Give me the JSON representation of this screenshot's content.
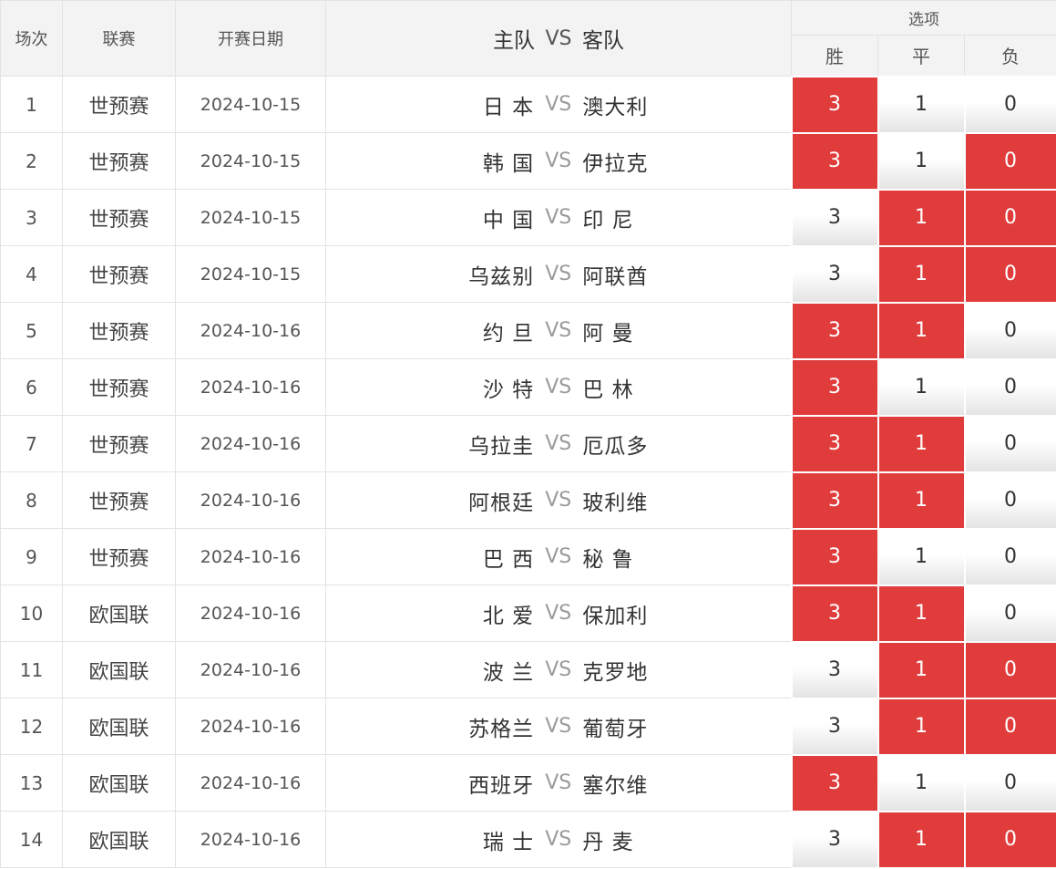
{
  "header": {
    "col_no": "场次",
    "col_league": "联赛",
    "col_date": "开赛日期",
    "col_home": "主队",
    "col_vs": "VS",
    "col_away": "客队",
    "col_options": "选项",
    "opt_win": "胜",
    "opt_draw": "平",
    "opt_loss": "负"
  },
  "colors": {
    "selected": "#e03c3c",
    "vs": "#9a9a9a"
  },
  "matches": [
    {
      "no": "1",
      "league": "世预赛",
      "date": "2024-10-15",
      "home": "日 本",
      "vs": "VS",
      "away": "澳大利",
      "win": "3",
      "draw": "1",
      "loss": "0",
      "sel": [
        true,
        false,
        false
      ]
    },
    {
      "no": "2",
      "league": "世预赛",
      "date": "2024-10-15",
      "home": "韩 国",
      "vs": "VS",
      "away": "伊拉克",
      "win": "3",
      "draw": "1",
      "loss": "0",
      "sel": [
        true,
        false,
        true
      ]
    },
    {
      "no": "3",
      "league": "世预赛",
      "date": "2024-10-15",
      "home": "中 国",
      "vs": "VS",
      "away": "印 尼",
      "win": "3",
      "draw": "1",
      "loss": "0",
      "sel": [
        false,
        true,
        true
      ]
    },
    {
      "no": "4",
      "league": "世预赛",
      "date": "2024-10-15",
      "home": "乌兹别",
      "vs": "VS",
      "away": "阿联酋",
      "win": "3",
      "draw": "1",
      "loss": "0",
      "sel": [
        false,
        true,
        true
      ]
    },
    {
      "no": "5",
      "league": "世预赛",
      "date": "2024-10-16",
      "home": "约 旦",
      "vs": "VS",
      "away": "阿 曼",
      "win": "3",
      "draw": "1",
      "loss": "0",
      "sel": [
        true,
        true,
        false
      ]
    },
    {
      "no": "6",
      "league": "世预赛",
      "date": "2024-10-16",
      "home": "沙 特",
      "vs": "VS",
      "away": "巴 林",
      "win": "3",
      "draw": "1",
      "loss": "0",
      "sel": [
        true,
        false,
        false
      ]
    },
    {
      "no": "7",
      "league": "世预赛",
      "date": "2024-10-16",
      "home": "乌拉圭",
      "vs": "VS",
      "away": "厄瓜多",
      "win": "3",
      "draw": "1",
      "loss": "0",
      "sel": [
        true,
        true,
        false
      ]
    },
    {
      "no": "8",
      "league": "世预赛",
      "date": "2024-10-16",
      "home": "阿根廷",
      "vs": "VS",
      "away": "玻利维",
      "win": "3",
      "draw": "1",
      "loss": "0",
      "sel": [
        true,
        true,
        false
      ]
    },
    {
      "no": "9",
      "league": "世预赛",
      "date": "2024-10-16",
      "home": "巴 西",
      "vs": "VS",
      "away": "秘 鲁",
      "win": "3",
      "draw": "1",
      "loss": "0",
      "sel": [
        true,
        false,
        false
      ]
    },
    {
      "no": "10",
      "league": "欧国联",
      "date": "2024-10-16",
      "home": "北 爱",
      "vs": "VS",
      "away": "保加利",
      "win": "3",
      "draw": "1",
      "loss": "0",
      "sel": [
        true,
        true,
        false
      ]
    },
    {
      "no": "11",
      "league": "欧国联",
      "date": "2024-10-16",
      "home": "波 兰",
      "vs": "VS",
      "away": "克罗地",
      "win": "3",
      "draw": "1",
      "loss": "0",
      "sel": [
        false,
        true,
        true
      ]
    },
    {
      "no": "12",
      "league": "欧国联",
      "date": "2024-10-16",
      "home": "苏格兰",
      "vs": "VS",
      "away": "葡萄牙",
      "win": "3",
      "draw": "1",
      "loss": "0",
      "sel": [
        false,
        true,
        true
      ]
    },
    {
      "no": "13",
      "league": "欧国联",
      "date": "2024-10-16",
      "home": "西班牙",
      "vs": "VS",
      "away": "塞尔维",
      "win": "3",
      "draw": "1",
      "loss": "0",
      "sel": [
        true,
        false,
        false
      ]
    },
    {
      "no": "14",
      "league": "欧国联",
      "date": "2024-10-16",
      "home": "瑞 士",
      "vs": "VS",
      "away": "丹 麦",
      "win": "3",
      "draw": "1",
      "loss": "0",
      "sel": [
        false,
        true,
        true
      ]
    }
  ]
}
